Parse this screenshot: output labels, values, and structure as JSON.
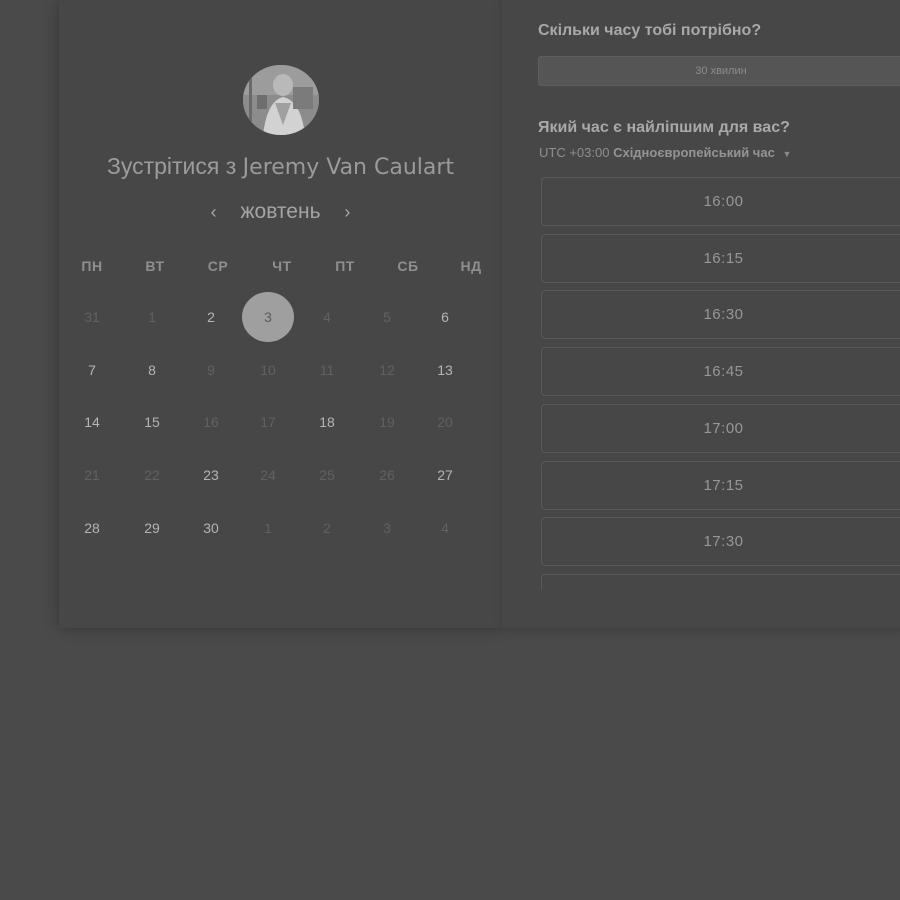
{
  "calendar": {
    "title_prefix": "Зустрітися з",
    "host_name": "Jeremy Van Caulart",
    "month": "жовтень",
    "prev_arrow": "‹",
    "next_arrow": "›",
    "weekdays": [
      "ПН",
      "ВТ",
      "СР",
      "ЧТ",
      "ПТ",
      "СБ",
      "НД"
    ],
    "weeks": [
      [
        {
          "d": "31",
          "avail": false
        },
        {
          "d": "1",
          "avail": false
        },
        {
          "d": "2",
          "avail": true
        },
        {
          "d": "3",
          "avail": true,
          "selected": true
        },
        {
          "d": "4",
          "avail": false
        },
        {
          "d": "5",
          "avail": false
        },
        {
          "d": "6",
          "avail": true
        }
      ],
      [
        {
          "d": "7",
          "avail": true
        },
        {
          "d": "8",
          "avail": true
        },
        {
          "d": "9",
          "avail": false
        },
        {
          "d": "10",
          "avail": false
        },
        {
          "d": "11",
          "avail": false
        },
        {
          "d": "12",
          "avail": false
        },
        {
          "d": "13",
          "avail": true
        }
      ],
      [
        {
          "d": "14",
          "avail": true
        },
        {
          "d": "15",
          "avail": true
        },
        {
          "d": "16",
          "avail": false
        },
        {
          "d": "17",
          "avail": false
        },
        {
          "d": "18",
          "avail": true
        },
        {
          "d": "19",
          "avail": false
        },
        {
          "d": "20",
          "avail": false
        }
      ],
      [
        {
          "d": "21",
          "avail": false
        },
        {
          "d": "22",
          "avail": false
        },
        {
          "d": "23",
          "avail": true
        },
        {
          "d": "24",
          "avail": false
        },
        {
          "d": "25",
          "avail": false
        },
        {
          "d": "26",
          "avail": false
        },
        {
          "d": "27",
          "avail": true
        }
      ],
      [
        {
          "d": "28",
          "avail": true
        },
        {
          "d": "29",
          "avail": true
        },
        {
          "d": "30",
          "avail": true
        },
        {
          "d": "1",
          "avail": false
        },
        {
          "d": "2",
          "avail": false
        },
        {
          "d": "3",
          "avail": false
        },
        {
          "d": "4",
          "avail": false
        }
      ]
    ]
  },
  "booking": {
    "duration_question": "Скільки часу тобі потрібно?",
    "duration_value": "30 хвилин",
    "time_question": "Який час є найліпшим для вас?",
    "timezone_offset": "UTC +03:00",
    "timezone_name": "Східноєвропейський час",
    "time_slots": [
      "16:00",
      "16:15",
      "16:30",
      "16:45",
      "17:00",
      "17:15",
      "17:30",
      ""
    ]
  }
}
